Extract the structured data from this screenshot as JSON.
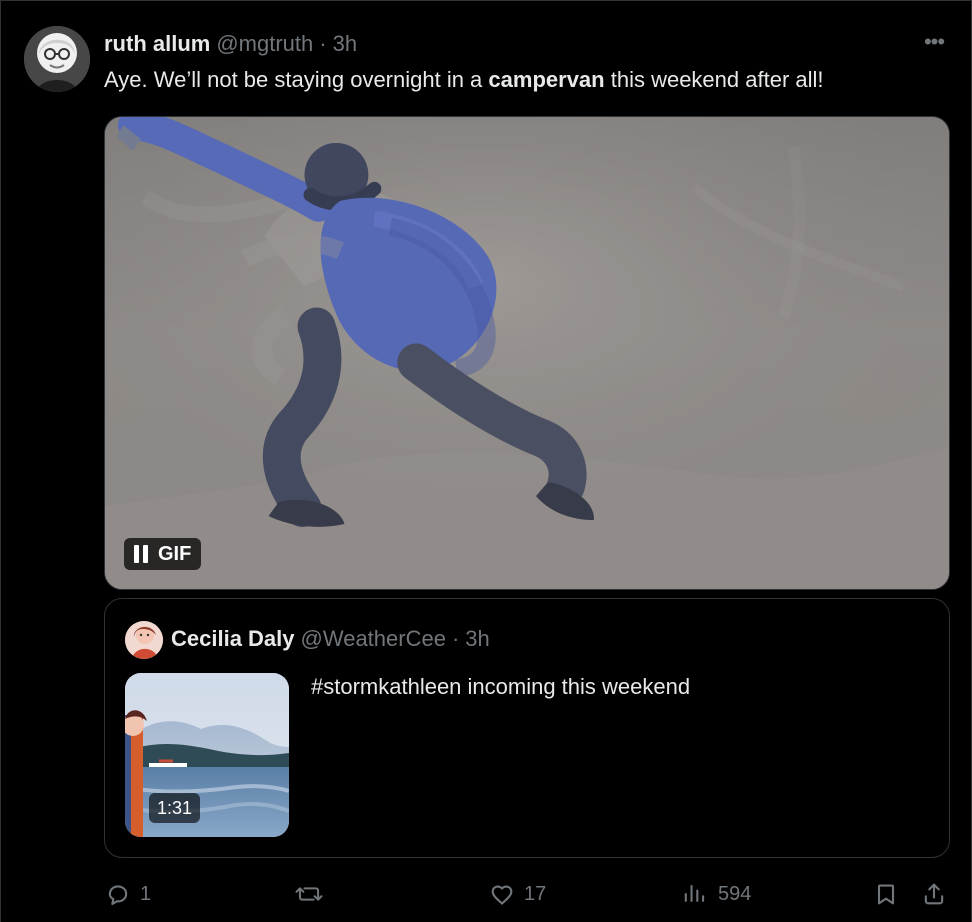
{
  "tweet": {
    "author_name": "ruth allum",
    "author_handle": "@mgtruth",
    "separator": "·",
    "time": "3h",
    "text_prefix": "Aye. We’ll not be staying overnight in a ",
    "text_bold": "campervan",
    "text_suffix": " this weekend after all!",
    "more_icon": "more-horizontal-icon",
    "more_label": "•••",
    "media": {
      "type": "gif",
      "badge_label": "GIF",
      "pause_icon": "pause-icon"
    }
  },
  "quote": {
    "author_name": "Cecilia Daly",
    "author_handle": "@WeatherCee",
    "separator": "·",
    "time": "3h",
    "text": "#stormkathleen incoming this weekend",
    "video_duration": "1:31"
  },
  "actions": {
    "reply_count": "1",
    "repost_count": "",
    "like_count": "17",
    "views_count": "594",
    "reply_icon": "reply-icon",
    "repost_icon": "repost-icon",
    "like_icon": "heart-icon",
    "views_icon": "views-icon",
    "bookmark_icon": "bookmark-icon",
    "share_icon": "share-icon"
  },
  "colors": {
    "background": "#000000",
    "text_primary": "#e7e9ea",
    "text_secondary": "#71767b",
    "border": "#2f3336"
  }
}
